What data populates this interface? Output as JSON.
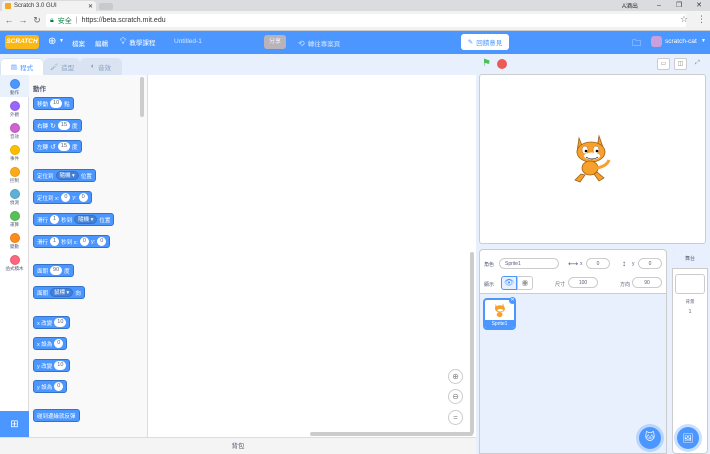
{
  "browser": {
    "tab_title": "Scratch 3.0 GUI",
    "user": "A酒出",
    "secure_label": "安全",
    "url": "https://beta.scratch.mit.edu"
  },
  "menubar": {
    "logo": "SCRATCH",
    "file": "檔案",
    "edit": "編輯",
    "tutorials": "教學課程",
    "project_title": "Untitled-1",
    "share": "分享",
    "see_project": "轉往專案頁",
    "my_stuff": "回饋意見",
    "username": "scratch-cat"
  },
  "editor_tabs": {
    "code": "程式",
    "costumes": "造型",
    "sounds": "音效"
  },
  "categories": [
    {
      "label": "動作",
      "color": "#4c97ff"
    },
    {
      "label": "外觀",
      "color": "#9966ff"
    },
    {
      "label": "音效",
      "color": "#cf63cf"
    },
    {
      "label": "事件",
      "color": "#ffbf00"
    },
    {
      "label": "控制",
      "color": "#ffab19"
    },
    {
      "label": "偵測",
      "color": "#5cb1d6"
    },
    {
      "label": "運算",
      "color": "#59c059"
    },
    {
      "label": "變數",
      "color": "#ff8c1a"
    },
    {
      "label": "函式積木",
      "color": "#ff6680"
    }
  ],
  "palette": {
    "heading": "動作",
    "blocks": {
      "move": {
        "a": "移動",
        "v": "10",
        "b": "點"
      },
      "turn_right": {
        "a": "右轉",
        "v": "15",
        "b": "度"
      },
      "turn_left": {
        "a": "左轉",
        "v": "15",
        "b": "度"
      },
      "goto": {
        "a": "定位到",
        "dd": "隨機",
        "b": "位置"
      },
      "goto_xy": {
        "a": "定位到 x:",
        "x": "0",
        "ylbl": "y:",
        "y": "0"
      },
      "glide": {
        "a": "滑行",
        "v": "1",
        "b": "秒到",
        "dd": "隨機",
        "c": "位置"
      },
      "glide_xy": {
        "a": "滑行",
        "v": "1",
        "b": "秒到 x:",
        "x": "0",
        "ylbl": "y:",
        "y": "0"
      },
      "point_dir": {
        "a": "面朝",
        "v": "90",
        "b": "度"
      },
      "point_to": {
        "a": "面朝",
        "dd": "鼠標",
        "b": "向"
      },
      "change_x": {
        "a": "x 改變",
        "v": "10"
      },
      "set_x": {
        "a": "x 設為",
        "v": "0"
      },
      "change_y": {
        "a": "y 改變",
        "v": "10"
      },
      "set_y": {
        "a": "y 設為",
        "v": "0"
      },
      "bounce": {
        "a": "碰到邊緣就反彈"
      }
    }
  },
  "backpack": "背包",
  "sprite_info": {
    "sprite_label": "角色",
    "sprite_name": "Sprite1",
    "x_label": "x",
    "x": "0",
    "y_label": "y",
    "y": "0",
    "show_label": "顯示",
    "size_label": "尺寸",
    "size": "100",
    "direction_label": "方向",
    "direction": "90"
  },
  "sprites": [
    {
      "name": "Sprite1"
    }
  ],
  "stage_panel": {
    "header": "舞台",
    "backdrops_label": "背景",
    "backdrops_count": "1"
  }
}
